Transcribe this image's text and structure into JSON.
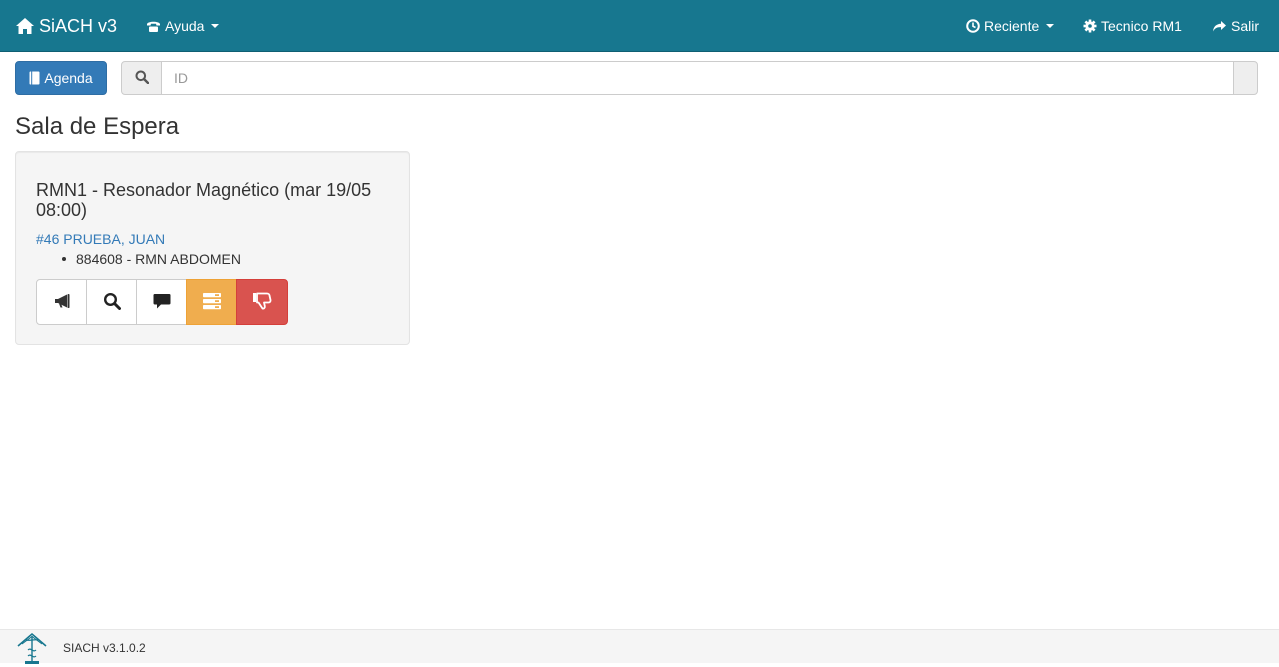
{
  "navbar": {
    "brand": "SiACH v3",
    "help_label": "Ayuda",
    "recent_label": "Reciente",
    "user_label": "Tecnico RM1",
    "logout_label": "Salir",
    "background": "#17778f"
  },
  "toolbar": {
    "agenda_label": "Agenda",
    "search_placeholder": "ID",
    "search_value": ""
  },
  "page": {
    "title": "Sala de Espera"
  },
  "waiting_card": {
    "title": "RMN1 - Resonador Magnético (mar 19/05 08:00)",
    "patient": "#46 PRUEBA, JUAN",
    "studies": [
      "884608 - RMN ABDOMEN"
    ],
    "actions": [
      {
        "icon": "bullhorn-icon"
      },
      {
        "icon": "search-icon"
      },
      {
        "icon": "comment-icon"
      },
      {
        "icon": "tasks-icon",
        "color": "#f0ad4e"
      },
      {
        "icon": "thumbs-down-icon",
        "color": "#d9534f"
      }
    ]
  },
  "footer": {
    "version": "SIACH v3.1.0.2",
    "logo_icon": "caduceus-logo-icon"
  },
  "colors": {
    "primary": "#337ab7",
    "warning": "#f0ad4e",
    "danger": "#d9534f",
    "link": "#337ab7"
  }
}
